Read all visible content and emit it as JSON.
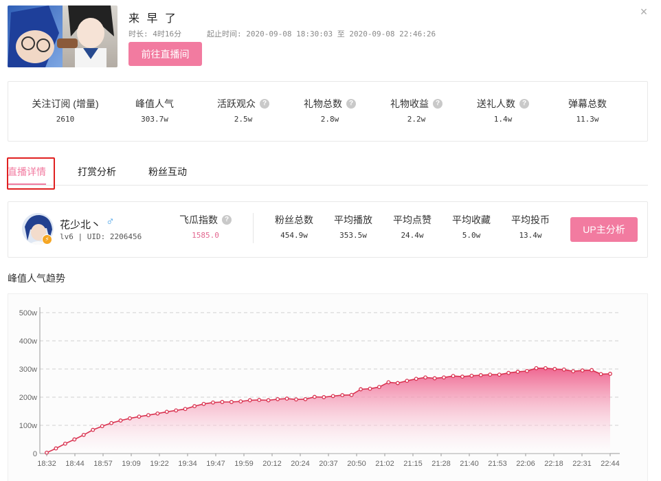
{
  "stream": {
    "title": "来 早 了",
    "duration_label": "时长:",
    "duration_value": "4时16分",
    "time_label": "起止时间:",
    "time_value": "2020-09-08 18:30:03 至 2020-09-08 22:46:26",
    "go_button": "前往直播间",
    "close_glyph": "×"
  },
  "stats": [
    {
      "label": "关注订阅 (增量)",
      "value": "2610",
      "help": false
    },
    {
      "label": "峰值人气",
      "value": "303.7w",
      "help": false
    },
    {
      "label": "活跃观众",
      "value": "2.5w",
      "help": true
    },
    {
      "label": "礼物总数",
      "value": "2.8w",
      "help": true
    },
    {
      "label": "礼物收益",
      "value": "2.2w",
      "help": true
    },
    {
      "label": "送礼人数",
      "value": "1.4w",
      "help": true
    },
    {
      "label": "弹幕总数",
      "value": "11.3w",
      "help": false
    }
  ],
  "help_glyph": "?",
  "tabs": [
    "直播详情",
    "打赏分析",
    "粉丝互动"
  ],
  "up": {
    "name": "花少北丶",
    "gender_glyph": "♂",
    "level_uid": "lv6 | UID: 2206456",
    "badge_glyph": "⚡",
    "index_label": "飞瓜指数",
    "index_value": "1585.0",
    "stats": [
      {
        "label": "粉丝总数",
        "value": "454.9w"
      },
      {
        "label": "平均播放",
        "value": "353.5w"
      },
      {
        "label": "平均点赞",
        "value": "24.4w"
      },
      {
        "label": "平均收藏",
        "value": "5.0w"
      },
      {
        "label": "平均投币",
        "value": "13.4w"
      }
    ],
    "button": "UP主分析"
  },
  "colors": {
    "accent": "#f27ba0",
    "line": "#d9314f",
    "highlight_box": "#e02020"
  },
  "chart_data": {
    "type": "area",
    "title": "峰值人气趋势",
    "ylim": [
      0,
      500
    ],
    "y_ticks": [
      "0",
      "100w",
      "200w",
      "300w",
      "400w",
      "500w"
    ],
    "x_ticks": [
      "18:32",
      "18:44",
      "18:57",
      "19:09",
      "19:22",
      "19:34",
      "19:47",
      "19:59",
      "20:12",
      "20:24",
      "20:37",
      "20:50",
      "21:02",
      "21:15",
      "21:28",
      "21:40",
      "21:53",
      "22:06",
      "22:18",
      "22:31",
      "22:44"
    ],
    "grid": true,
    "series": [
      {
        "values": [
          3,
          18,
          35,
          50,
          66,
          84,
          97,
          108,
          117,
          125,
          131,
          136,
          142,
          148,
          153,
          158,
          168,
          176,
          181,
          183,
          183,
          185,
          189,
          190,
          189,
          193,
          195,
          192,
          193,
          201,
          200,
          204,
          207,
          208,
          228,
          230,
          236,
          253,
          250,
          258,
          265,
          270,
          267,
          270,
          275,
          273,
          276,
          278,
          280,
          280,
          286,
          290,
          293,
          303,
          303,
          300,
          298,
          292,
          295,
          296,
          282,
          283
        ]
      }
    ]
  }
}
